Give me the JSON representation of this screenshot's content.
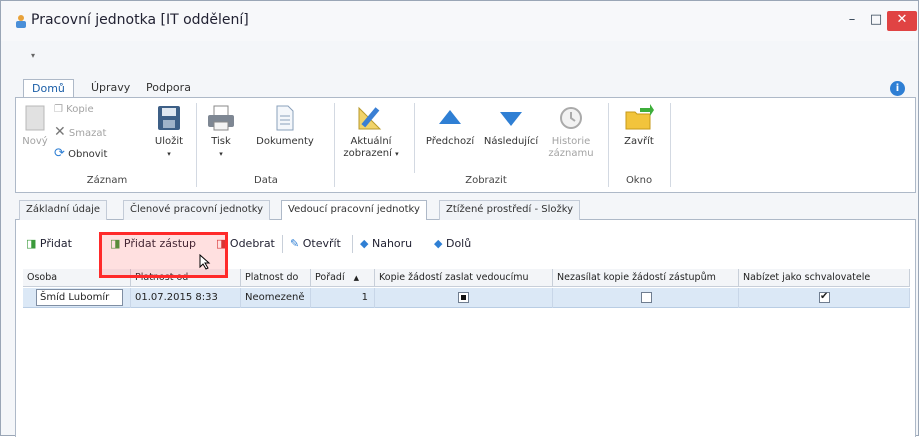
{
  "window": {
    "title": "Pracovní jednotka [IT oddělení]",
    "minimize_glyph": "–",
    "maximize_glyph": "□",
    "close_glyph": "✕",
    "qat_glyph": "▾"
  },
  "ribbon_tabs": [
    {
      "label": "Domů",
      "active": true
    },
    {
      "label": "Úpravy",
      "active": false
    },
    {
      "label": "Podpora",
      "active": false
    }
  ],
  "ribbon": {
    "groups": {
      "zaznam": "Záznam",
      "data": "Data",
      "zobrazit": "Zobrazit",
      "okno": "Okno"
    },
    "buttons": {
      "novy": "Nový",
      "kopie": "Kopie",
      "smazat": "Smazat",
      "obnovit": "Obnovit",
      "ulozit": "Uložit",
      "tisk": "Tisk",
      "dokumenty": "Dokumenty",
      "aktualni_1": "Aktuální",
      "aktualni_2": "zobrazení",
      "predchozi": "Předchozí",
      "nasledujici": "Následující",
      "historie_1": "Historie",
      "historie_2": "záznamu",
      "zavrit": "Zavřít"
    }
  },
  "page_tabs": [
    {
      "label": "Základní údaje",
      "active": false
    },
    {
      "label": "Členové pracovní jednotky",
      "active": false
    },
    {
      "label": "Vedoucí pracovní jednotky",
      "active": true
    },
    {
      "label": "Ztížené prostředí - Složky",
      "active": false
    }
  ],
  "toolbar": {
    "pridat": "Přidat",
    "pridat_zastup": "Přidat zástup",
    "odebrat": "Odebrat",
    "otevrit": "Otevřít",
    "nahoru": "Nahoru",
    "dolu": "Dolů"
  },
  "grid": {
    "columns": [
      "Osoba",
      "Platnost od",
      "Platnost do",
      "Pořadí",
      "Kopie žádostí zaslat vedoucímu",
      "Nezasílat kopie žádostí zástupům",
      "Nabízet jako schvalovatele"
    ],
    "sort_indicator": "▲",
    "rows": [
      {
        "osoba": "Šmíd Lubomír",
        "platnost_od": "01.07.2015 8:33",
        "platnost_do": "Neomezeně",
        "poradi": "1",
        "kopie_vedoucimu": "indeterminate",
        "nezasilat_zastupum": false,
        "nabizet_schvalovatele": true
      }
    ]
  },
  "colors": {
    "accent_blue": "#1c5fa8",
    "highlight_red": "#ff2a2a",
    "selected_row": "#dbe8f6",
    "close_button": "#e04343"
  }
}
